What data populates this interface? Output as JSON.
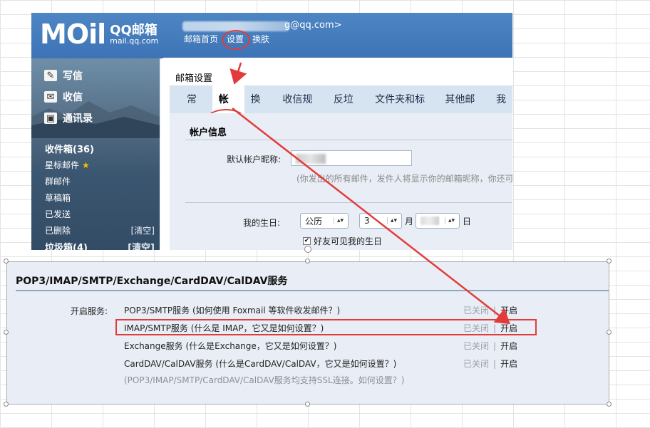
{
  "header": {
    "logo_mark": "MOil",
    "logo_name": "QQ邮箱",
    "logo_domain": "mail.qq.com",
    "user_email": "g@qq.com>",
    "nav": [
      "邮箱首页",
      "设置",
      "换肤"
    ]
  },
  "sidebar": {
    "actions": [
      {
        "label": "写信",
        "icon": "pencil-icon"
      },
      {
        "label": "收信",
        "icon": "envelope-icon"
      },
      {
        "label": "通讯录",
        "icon": "contacts-icon"
      }
    ],
    "folders": [
      {
        "label": "收件箱(36)",
        "bold": true,
        "clear": ""
      },
      {
        "label": "星标邮件",
        "star": "★",
        "clear": ""
      },
      {
        "label": "群邮件",
        "clear": ""
      },
      {
        "label": "草稿箱",
        "clear": ""
      },
      {
        "label": "已发送",
        "clear": ""
      },
      {
        "label": "已删除",
        "clear": "[清空]"
      },
      {
        "label": "垃圾箱(4)",
        "bold": true,
        "clear": "[清空]"
      }
    ]
  },
  "settings": {
    "title": "邮箱设置",
    "tabs": [
      "常规",
      "帐户",
      "换肤",
      "收信规则",
      "反垃圾",
      "文件夹和标签",
      "其他邮箱",
      "我"
    ],
    "active_tab": "帐户",
    "section_title": "帐户信息",
    "nickname_label": "默认帐户昵称:",
    "nickname_hint": "(你发出的所有邮件，发件人将显示你的邮箱昵称，你还可",
    "birthday_label": "我的生日:",
    "calendar_select": "公历",
    "month_value": "3",
    "month_unit": "月",
    "day_unit": "日",
    "friends_visible_label": "好友可见我的生日",
    "friends_visible_checked": "✔"
  },
  "services": {
    "title": "POP3/IMAP/SMTP/Exchange/CardDAV/CalDAV服务",
    "label": "开启服务:",
    "rows": [
      {
        "name": "POP3/SMTP服务 (如何使用 Foxmail 等软件收发邮件？)",
        "off": "已关闭",
        "sep": "|",
        "on": "开启"
      },
      {
        "name": "IMAP/SMTP服务 (什么是 IMAP，它又是如何设置？)",
        "off": "已关闭",
        "sep": "|",
        "on": "开启"
      },
      {
        "name": "Exchange服务 (什么是Exchange，它又是如何设置？)",
        "off": "已关闭",
        "sep": "|",
        "on": "开启"
      },
      {
        "name": "CardDAV/CalDAV服务 (什么是CardDAV/CalDAV，它又是如何设置？)",
        "off": "已关闭",
        "sep": "|",
        "on": "开启"
      }
    ],
    "ssl_note": "(POP3/IMAP/SMTP/CardDAV/CalDAV服务均支持SSL连接。如何设置？)"
  },
  "colors": {
    "annotation_red": "#e33b3b",
    "header_blue": "#3d73b5",
    "panel_bg": "#e9eef6"
  }
}
